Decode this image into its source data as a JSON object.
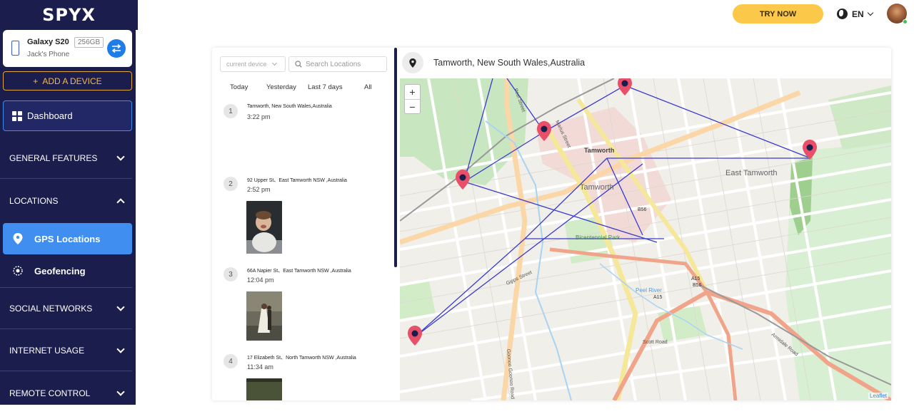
{
  "brand": {
    "logo": "SPYX"
  },
  "device": {
    "name": "Galaxy S20",
    "storage": "256GB",
    "owner": "Jack's Phone"
  },
  "sidebar": {
    "add_device": "ADD A DEVICE",
    "dashboard": "Dashboard",
    "sections": [
      {
        "label": "GENERAL FEATURES"
      },
      {
        "label": "LOCATIONS"
      },
      {
        "label": "SOCIAL NETWORKS"
      },
      {
        "label": "INTERNET USAGE"
      },
      {
        "label": "REMOTE CONTROL"
      }
    ],
    "locations_items": [
      {
        "label": "GPS Locations",
        "active": true
      },
      {
        "label": "Geofencing",
        "active": false
      }
    ]
  },
  "topbar": {
    "try_now": "TRY NOW",
    "language": "EN"
  },
  "filters": {
    "device_placeholder": "current device",
    "search_placeholder": "Search Locations",
    "tabs": [
      "Today",
      "Yesterday",
      "Last 7 days",
      "All"
    ]
  },
  "locations": [
    {
      "index": "1",
      "address": "Tamworth, New South Wales,Australia",
      "time": "3:22 pm",
      "has_photo": false
    },
    {
      "index": "2",
      "address": "92 Upper St、East Tamworth NSW ,Australia",
      "time": "2:52 pm",
      "has_photo": true
    },
    {
      "index": "3",
      "address": "66A Napier St、East Tamworth NSW ,Australia",
      "time": "12:04 pm",
      "has_photo": true
    },
    {
      "index": "4",
      "address": "17 Elizabeth St、North Tamworth NSW ,Australia",
      "time": "11:34 am",
      "has_photo": true
    }
  ],
  "map": {
    "title": "Tamworth, New South Wales,Australia",
    "zoom_in": "+",
    "zoom_out": "−",
    "attribution": "Leaflet",
    "labels": {
      "tamworth_center": "Tamworth",
      "tamworth_big": "Tamworth",
      "east_tamworth": "East Tamworth",
      "bicentennial": "Bicentennial Park",
      "peel_river": "Peel River",
      "route_a15": "A15",
      "route_b56": "B56",
      "route_a15_b": "A15",
      "route_b56_b": "B56",
      "marius_st": "Marius Street",
      "peel_st": "Peel Street",
      "armidale_rd": "Armidale Road",
      "scott_rd": "Scott Road",
      "gipps_st": "Gipps Street",
      "goonoo_rd": "Goonoo Goonoo Road"
    },
    "route_color": "#3a3ad0",
    "pin_color": "#e8506a"
  }
}
